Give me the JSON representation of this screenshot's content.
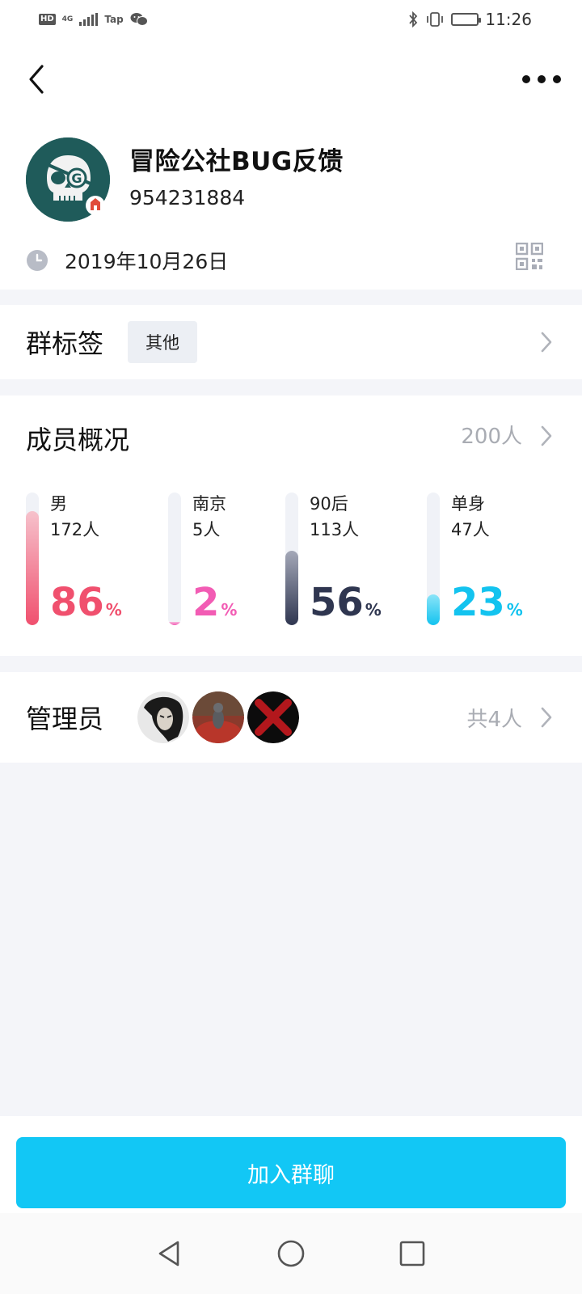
{
  "status_bar": {
    "hd": "HD",
    "network": "4G",
    "tap": "Tap",
    "time": "11:26"
  },
  "nav": {
    "back_icon": "chevron-left-icon",
    "more_icon": "more-horizontal-icon"
  },
  "group": {
    "name": "冒险公社BUG反馈",
    "id": "954231884",
    "avatar_letter": "G",
    "created_date": "2019年10月26日"
  },
  "tag_section": {
    "label": "群标签",
    "tag": "其他"
  },
  "members": {
    "title": "成员概况",
    "count": "200人",
    "stats": [
      {
        "label": "男",
        "count": "172人",
        "percent": 86,
        "percent_text": "86",
        "unit": "%",
        "color": "#f0506e"
      },
      {
        "label": "南京",
        "count": "5人",
        "percent": 2,
        "percent_text": "2",
        "unit": "%",
        "color": "#f25cb4"
      },
      {
        "label": "90后",
        "count": "113人",
        "percent": 56,
        "percent_text": "56",
        "unit": "%",
        "color": "#2f3650"
      },
      {
        "label": "单身",
        "count": "47人",
        "percent": 23,
        "percent_text": "23",
        "unit": "%",
        "color": "#13c3ef"
      }
    ]
  },
  "admins": {
    "label": "管理员",
    "count": "共4人"
  },
  "join_button": "加入群聊",
  "colors": {
    "accent": "#12c7f5",
    "background": "#f4f5f9",
    "muted_text": "#a9acb3"
  }
}
